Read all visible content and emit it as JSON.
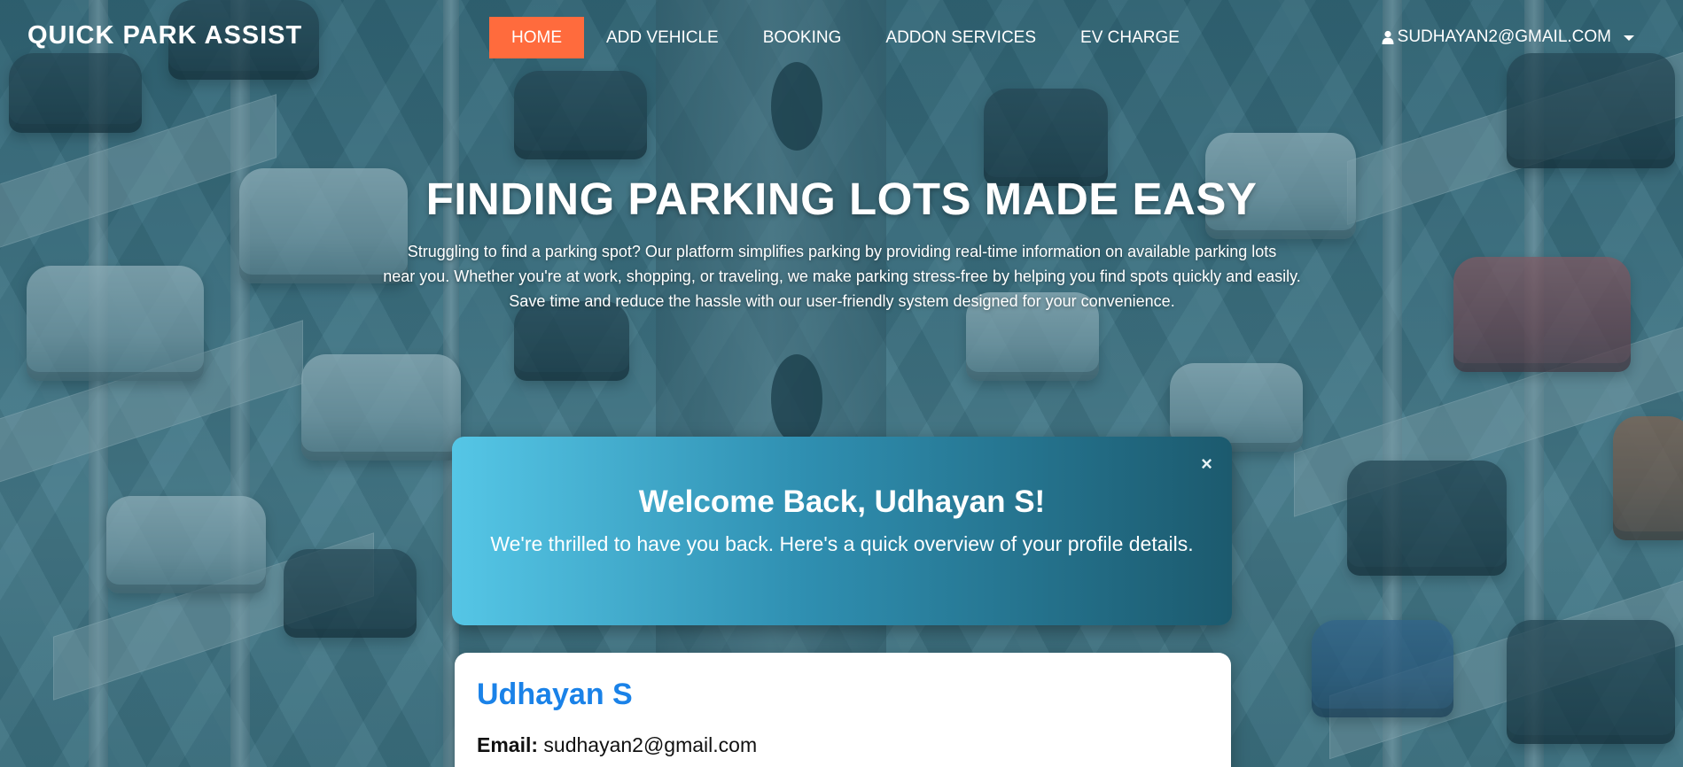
{
  "navbar": {
    "brand": "QUICK PARK ASSIST",
    "links": [
      {
        "label": "HOME",
        "active": true
      },
      {
        "label": "ADD VEHICLE",
        "active": false
      },
      {
        "label": "BOOKING",
        "active": false
      },
      {
        "label": "ADDON SERVICES",
        "active": false
      },
      {
        "label": "EV CHARGE",
        "active": false
      }
    ],
    "user_email": "SUDHAYAN2@GMAIL.COM",
    "user_icon": "user-icon",
    "dropdown_icon": "caret-down-icon"
  },
  "hero": {
    "title": "FINDING PARKING LOTS MADE EASY",
    "description_lines": [
      "Struggling to find a parking spot? Our platform simplifies parking by providing real-time information on available parking lots",
      "near you. Whether you're at work, shopping, or traveling, we make parking stress-free by helping you find spots quickly and easily.",
      "Save time and reduce the hassle with our user-friendly system designed for your convenience."
    ]
  },
  "welcome": {
    "close_symbol": "×",
    "title": "Welcome Back, Udhayan S!",
    "subtitle": "We're thrilled to have you back. Here's a quick overview of your profile details."
  },
  "profile": {
    "name": "Udhayan S",
    "email_label": "Email:",
    "email_value": "sudhayan2@gmail.com"
  },
  "colors": {
    "accent": "#ff6b3d",
    "profile_name": "#1a82e8",
    "overlay": "#1e5a6e"
  }
}
